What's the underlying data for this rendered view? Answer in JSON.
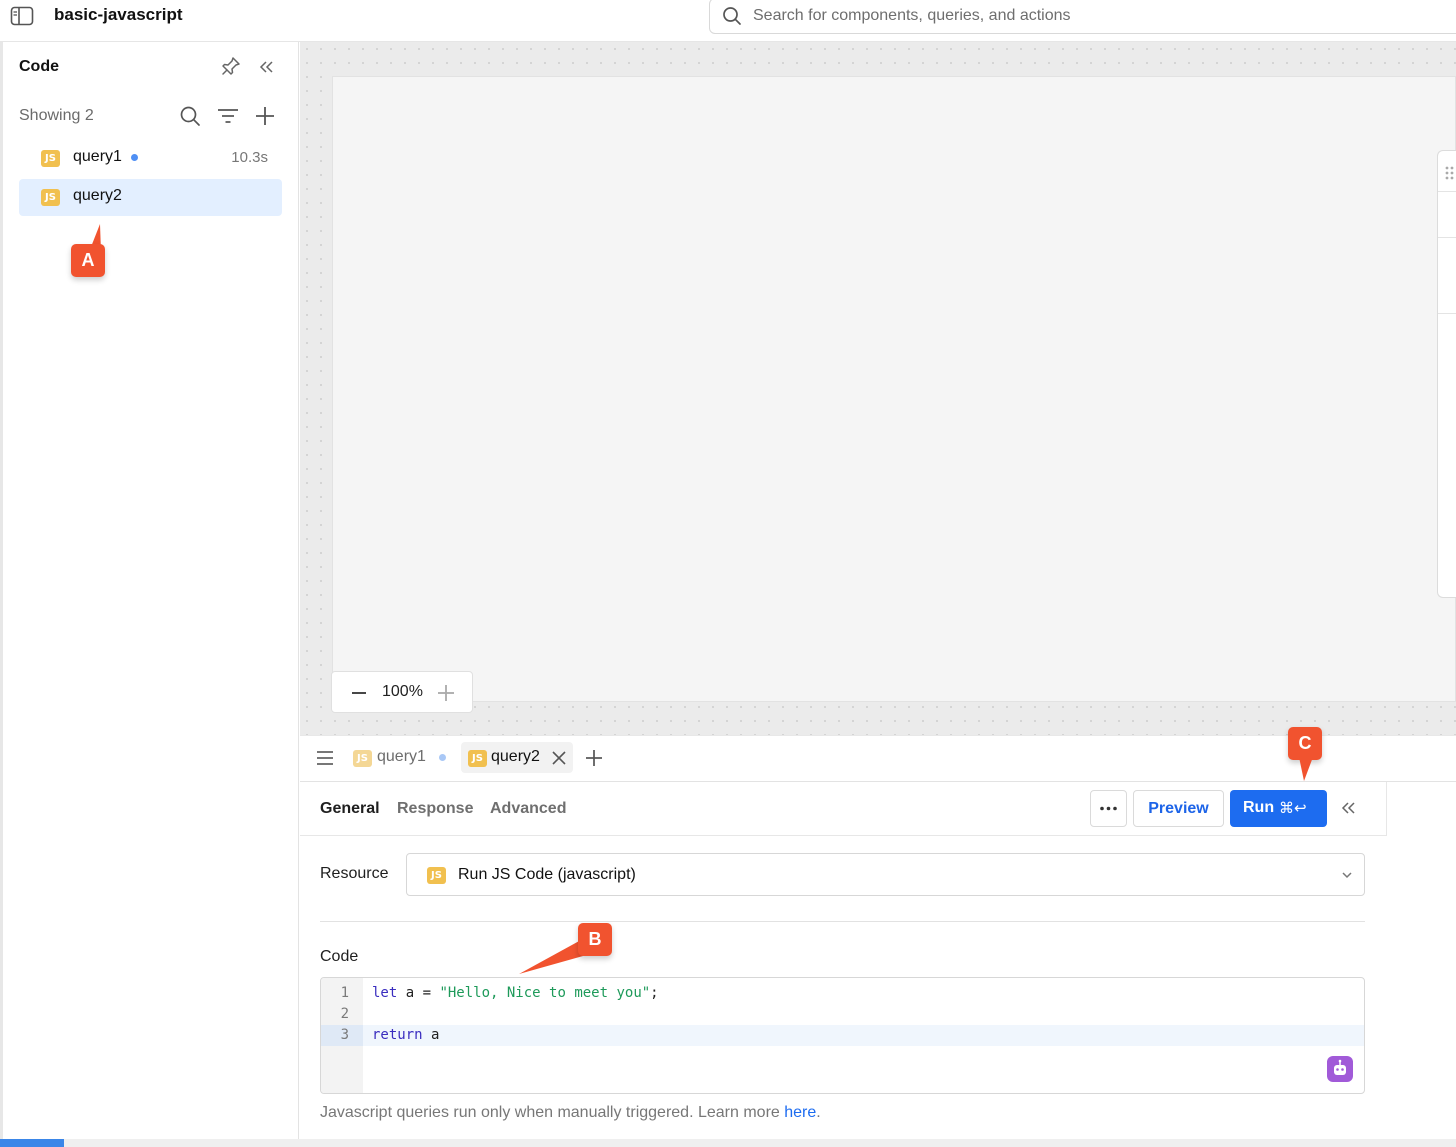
{
  "header": {
    "app_title": "basic-javascript",
    "search_placeholder": "Search for components, queries, and actions"
  },
  "code_panel": {
    "title": "Code",
    "showing_text": "Showing 2",
    "queries": [
      {
        "badge": "JS",
        "name": "query1",
        "runtime": "10.3s",
        "status_dot": true,
        "selected": false
      },
      {
        "badge": "JS",
        "name": "query2",
        "runtime": "",
        "status_dot": false,
        "selected": true
      }
    ]
  },
  "canvas": {
    "zoom_value": "100%"
  },
  "editor": {
    "tabs": [
      {
        "badge": "JS",
        "label": "query1",
        "unsaved_dot": true,
        "active": false
      },
      {
        "badge": "JS",
        "label": "query2",
        "unsaved_dot": false,
        "active": true
      }
    ],
    "subtabs": [
      "General",
      "Response",
      "Advanced"
    ],
    "active_subtab": "General",
    "preview_label": "Preview",
    "run_label": "Run",
    "run_shortcut": "⌘↩",
    "resource_label": "Resource",
    "resource_badge": "JS",
    "resource_value": "Run JS Code (javascript)",
    "code_label": "Code",
    "code_lines": [
      {
        "number": "1",
        "text": "let a = \"Hello, Nice to meet you\";"
      },
      {
        "number": "2",
        "text": ""
      },
      {
        "number": "3",
        "text": "return a"
      }
    ],
    "active_line": 3,
    "footnote_text": "Javascript queries run only when manually triggered. Learn more",
    "footnote_link": "here",
    "footnote_end": "."
  },
  "annotations": {
    "marker_a": "A",
    "marker_b": "B",
    "marker_c": "C"
  },
  "colors": {
    "accent": "#1d6cf0",
    "js_badge": "#f1c04f",
    "marker": "#f1532f",
    "selected_row": "#e3efff",
    "status_dot": "#4f8ff4"
  }
}
